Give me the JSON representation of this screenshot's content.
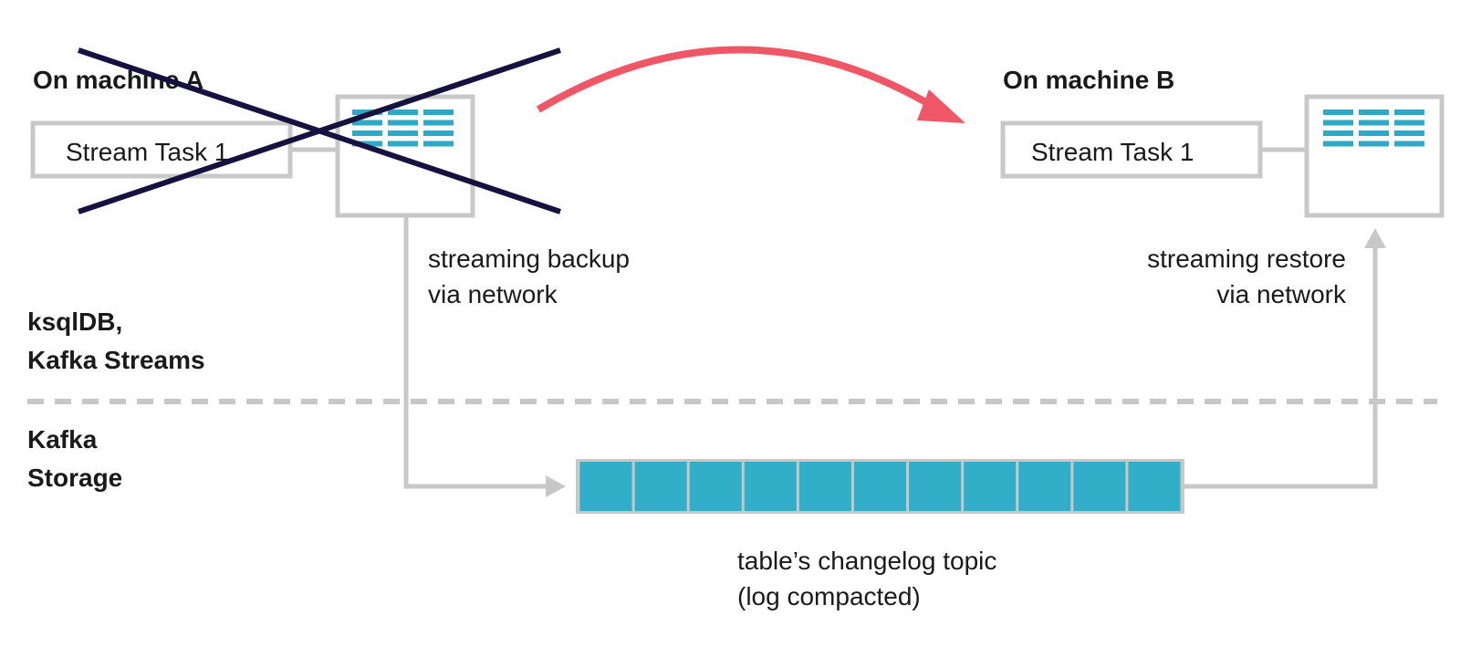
{
  "machine_a": {
    "title": "On machine A",
    "task_label": "Stream Task 1",
    "status": "crossed-out (failed)"
  },
  "machine_b": {
    "title": "On machine B",
    "task_label": "Stream Task 1"
  },
  "annotations": {
    "backup_line1": "streaming backup",
    "backup_line2": "via network",
    "restore_line1": "streaming restore",
    "restore_line2": "via network",
    "topic_line1": "table’s changelog topic",
    "topic_line2": "(log compacted)"
  },
  "layers": {
    "upper_line1": "ksqlDB,",
    "upper_line2": "Kafka Streams",
    "lower_line1": "Kafka",
    "lower_line2": "Storage"
  },
  "state_store": {
    "columns": 3,
    "rows": 4
  },
  "changelog": {
    "segments": 11
  },
  "icons": {
    "cross": "x-mark-icon",
    "migration_arrow": "curved-arrow-icon"
  },
  "colors": {
    "accent_teal": "#32afc8",
    "cross_navy": "#15123f",
    "arrow_red": "#ef5766",
    "line_gray": "#c8c8c8"
  }
}
